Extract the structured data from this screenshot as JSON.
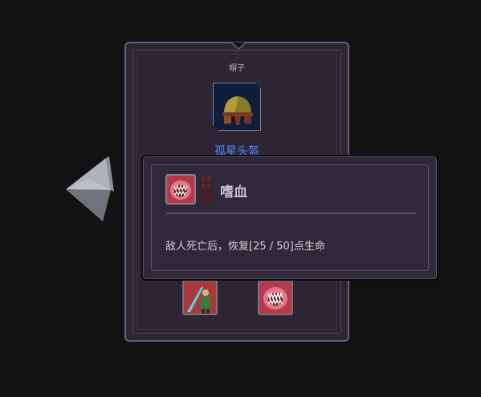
{
  "card": {
    "category": "帽子",
    "item_name": "孤星头盔",
    "item_icon": "helmet-icon",
    "skill_icons": [
      "sword-warrior-skill-icon",
      "fanged-mouth-skill-icon"
    ]
  },
  "tooltip": {
    "icon": "fanged-mouth-icon",
    "title": "嗜血",
    "description": "敌人死亡后，恢复[25 / 50]点生命"
  },
  "nav": {
    "prev_icon": "left-arrow-icon"
  },
  "colors": {
    "item_name": "#5a8cff",
    "panel": "#2b2534",
    "background": "#121212"
  }
}
